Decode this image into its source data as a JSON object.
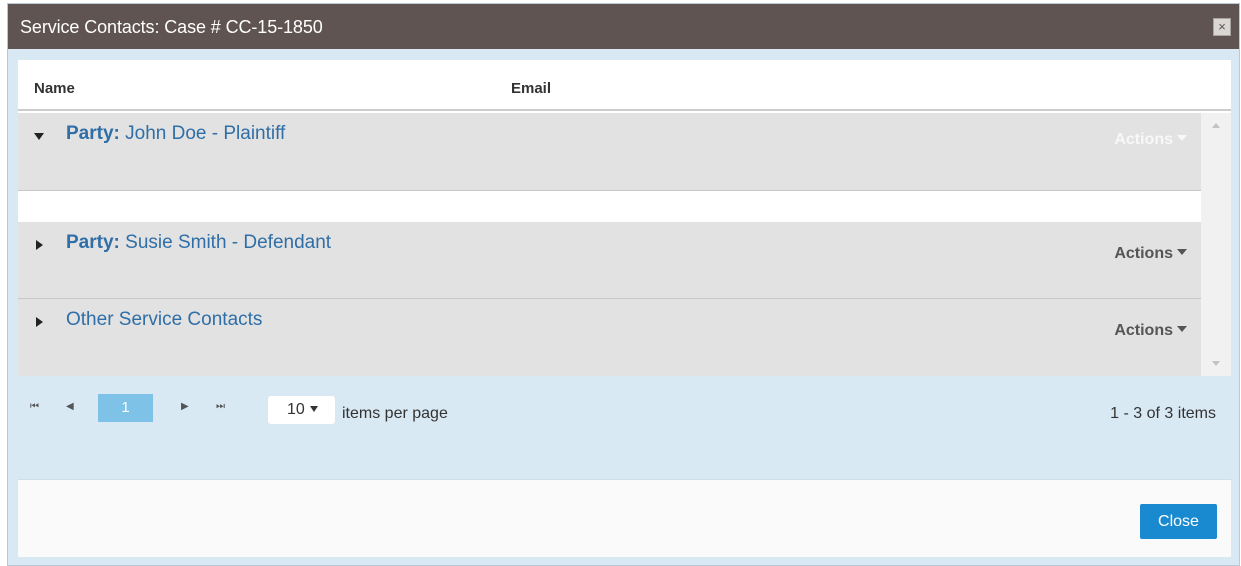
{
  "window": {
    "title": "Service Contacts: Case # CC-15-1850",
    "close_glyph": "×"
  },
  "grid": {
    "columns": [
      "Name",
      "Email"
    ],
    "groups": [
      {
        "prefix": "Party:",
        "label": "John Doe - Plaintiff",
        "expanded": true,
        "actions_label": "Actions"
      },
      {
        "prefix": "Party:",
        "label": "Susie Smith - Defendant",
        "expanded": false,
        "actions_label": "Actions"
      },
      {
        "prefix": "",
        "label": "Other Service Contacts",
        "expanded": false,
        "actions_label": "Actions"
      }
    ]
  },
  "pager": {
    "first_glyph": "⏮",
    "prev_glyph": "◀",
    "next_glyph": "▶",
    "last_glyph": "⏭",
    "current_page": "1",
    "page_size": "10",
    "page_size_label": "items per page",
    "info": "1 - 3 of 3 items"
  },
  "footer": {
    "close_label": "Close"
  },
  "colors": {
    "titlebar": "#5f5451",
    "link": "#2f6ea6",
    "primary_button": "#1a8ad0",
    "current_page": "#7ec2e8"
  }
}
